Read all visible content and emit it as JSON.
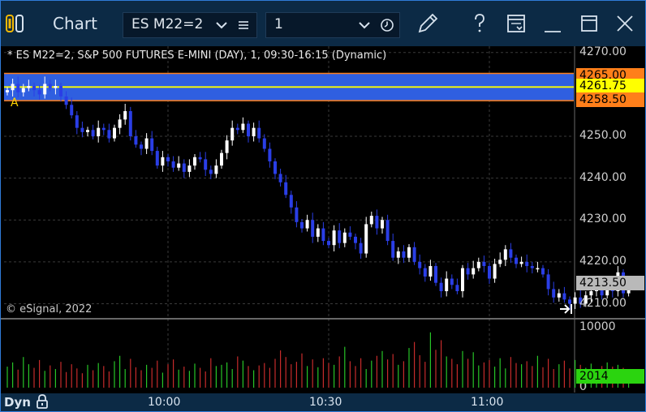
{
  "window": {
    "title": "Chart",
    "symbol": "ES M22=2",
    "interval": "1"
  },
  "icons": [
    "app-icon",
    "chevron-down-icon",
    "menu-icon",
    "clock-icon",
    "pencil-icon",
    "help-icon",
    "window-icon",
    "minimize-icon",
    "maximize-icon",
    "close-icon",
    "lock-icon",
    "scroll-to-end-icon"
  ],
  "chart": {
    "caption": "* ES M22=2, S&P 500 FUTURES E-MINI (DAY), 1, 09:30-16:15 (Dynamic)",
    "copyright": "© eSignal, 2022",
    "footer_label": "Dyn",
    "time_labels": [
      "10:00",
      "10:30",
      "11:00"
    ],
    "price_labels": [
      "4270.00",
      "4250.00",
      "4240.00",
      "4230.00",
      "4220.00",
      "4210.00"
    ],
    "volume_labels": [
      "10000",
      "0"
    ],
    "tags": {
      "upper": "4265.00",
      "mid": "4261.75",
      "lower": "4258.50",
      "last": "4213.50",
      "volume": "2014"
    },
    "colors": {
      "up": "#ffffff",
      "down": "#2a3ee6",
      "band": "#2f5fe0",
      "band_edge": "#ff7f1a",
      "mid_line": "#ffff00",
      "vol_up": "#27c427",
      "vol_down": "#c62b2b"
    }
  },
  "chart_data": {
    "type": "candlestick",
    "symbol": "ES M22=2",
    "x": [
      "09:30",
      "09:31",
      "09:32",
      "09:33",
      "09:34",
      "09:35",
      "09:36",
      "09:37",
      "09:38",
      "09:39",
      "09:40",
      "09:41",
      "09:42",
      "09:43",
      "09:44",
      "09:45",
      "09:46",
      "09:47",
      "09:48",
      "09:49",
      "09:50",
      "09:51",
      "09:52",
      "09:53",
      "09:54",
      "09:55",
      "09:56",
      "09:57",
      "09:58",
      "09:59",
      "10:00",
      "10:01",
      "10:02",
      "10:03",
      "10:04",
      "10:05",
      "10:06",
      "10:07",
      "10:08",
      "10:09",
      "10:10",
      "10:11",
      "10:12",
      "10:13",
      "10:14",
      "10:15",
      "10:16",
      "10:17",
      "10:18",
      "10:19",
      "10:20",
      "10:21",
      "10:22",
      "10:23",
      "10:24",
      "10:25",
      "10:26",
      "10:27",
      "10:28",
      "10:29",
      "10:30",
      "10:31",
      "10:32",
      "10:33",
      "10:34",
      "10:35",
      "10:36",
      "10:37",
      "10:38",
      "10:39",
      "10:40",
      "10:41",
      "10:42",
      "10:43",
      "10:44",
      "10:45",
      "10:46",
      "10:47",
      "10:48",
      "10:49",
      "10:50",
      "10:51",
      "10:52",
      "10:53",
      "10:54",
      "10:55",
      "10:56",
      "10:57",
      "10:58",
      "10:59",
      "11:00",
      "11:01",
      "11:02",
      "11:03",
      "11:04",
      "11:05",
      "11:06",
      "11:07",
      "11:08",
      "11:09",
      "11:10",
      "11:11",
      "11:12",
      "11:13",
      "11:14",
      "11:15",
      "11:16",
      "11:17",
      "11:18",
      "11:19",
      "11:20",
      "11:21",
      "11:22",
      "11:23",
      "11:24",
      "11:25",
      "11:26"
    ],
    "close": [
      4261.0,
      4262.5,
      4260.5,
      4261.5,
      4262.0,
      4261.0,
      4260.0,
      4262.5,
      4261.5,
      4262.0,
      4259.5,
      4257.5,
      4255.0,
      4252.0,
      4251.0,
      4251.5,
      4250.0,
      4252.0,
      4251.5,
      4249.5,
      4252.0,
      4254.0,
      4256.0,
      4250.0,
      4248.0,
      4247.0,
      4249.5,
      4246.5,
      4243.0,
      4245.0,
      4244.0,
      4242.5,
      4243.5,
      4241.5,
      4243.0,
      4245.0,
      4244.5,
      4242.0,
      4241.0,
      4243.0,
      4246.0,
      4249.0,
      4252.0,
      4251.5,
      4253.0,
      4250.0,
      4252.0,
      4249.5,
      4247.0,
      4244.0,
      4241.0,
      4239.0,
      4236.0,
      4233.0,
      4229.5,
      4228.0,
      4230.0,
      4226.0,
      4228.0,
      4225.0,
      4224.0,
      4227.5,
      4224.5,
      4227.0,
      4226.0,
      4224.5,
      4222.0,
      4229.0,
      4231.0,
      4228.0,
      4230.0,
      4225.0,
      4221.0,
      4222.5,
      4221.0,
      4223.5,
      4220.0,
      4218.5,
      4216.5,
      4219.0,
      4215.0,
      4213.0,
      4216.0,
      4214.5,
      4213.0,
      4218.5,
      4217.0,
      4218.5,
      4220.0,
      4219.0,
      4216.0,
      4219.5,
      4220.5,
      4223.0,
      4221.0,
      4219.5,
      4220.0,
      4219.0,
      4218.5,
      4218.5,
      4217.0,
      4213.5,
      4211.5,
      4212.5,
      4211.0,
      4210.0,
      4211.5,
      4210.0,
      4212.0,
      4213.0,
      4213.5,
      4212.0,
      4214.5,
      4213.0,
      4217.5,
      4212.5,
      4213.5
    ],
    "volume": [
      3500,
      4200,
      3000,
      5100,
      3900,
      3300,
      4600,
      2800,
      3700,
      3100,
      4300,
      2600,
      3900,
      3200,
      2400,
      3800,
      2900,
      4100,
      3600,
      2700,
      4400,
      5300,
      3100,
      4800,
      3400,
      2900,
      3800,
      3300,
      4500,
      2500,
      3900,
      4700,
      3000,
      3500,
      2800,
      4000,
      3300,
      2700,
      4900,
      3600,
      3800,
      4200,
      3100,
      5200,
      4500,
      3600,
      2900,
      3700,
      4100,
      3300,
      4800,
      6200,
      5100,
      3900,
      4300,
      5700,
      3600,
      4700,
      3400,
      4900,
      4100,
      3800,
      5200,
      6800,
      4400,
      3600,
      4900,
      3100,
      4500,
      5300,
      6100,
      4700,
      5600,
      3800,
      4400,
      6600,
      7600,
      5400,
      4300,
      9200,
      6300,
      7900,
      5200,
      4800,
      3900,
      6100,
      4800,
      5900,
      3700,
      4200,
      4600,
      3500,
      4900,
      3200,
      5100,
      4100,
      3900,
      4400,
      3600,
      5300,
      3400,
      4800,
      3100,
      3900,
      4500,
      3200,
      4600,
      3800,
      3300,
      4000,
      2900,
      3600,
      4200,
      3500,
      3800,
      3300,
      2014
    ],
    "ylim": [
      4207.0,
      4271.5
    ],
    "volume_ylim": [
      0,
      11200
    ],
    "levels": {
      "band_top": 4265.0,
      "band_mid": 4261.75,
      "band_bottom": 4258.5,
      "last": 4213.5
    },
    "y_ticks": [
      4270,
      4250,
      4240,
      4230,
      4220,
      4210
    ],
    "volume_ticks": [
      10000,
      0
    ],
    "last_volume": 2014
  }
}
